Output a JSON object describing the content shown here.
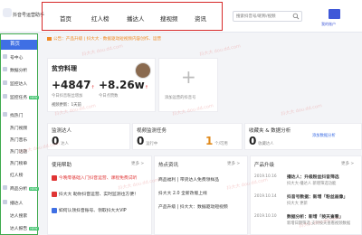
{
  "app": {
    "title": "抖音号运营助手"
  },
  "nav": {
    "items": [
      "首页",
      "红人榜",
      "播达人",
      "搜视频",
      "资讯"
    ]
  },
  "search": {
    "placeholder": "搜索抖音号/昵称/视频"
  },
  "user": {
    "label": "我的账户"
  },
  "sidebar": {
    "home": "首页",
    "items": [
      {
        "label": "号中心",
        "new": false
      },
      {
        "label": "数据分析",
        "new": false
      },
      {
        "label": "监控达人",
        "new": false
      },
      {
        "label": "监控任务",
        "new": true
      },
      {
        "label": "找热门",
        "new": false
      },
      {
        "label": "热门视频",
        "new": false
      },
      {
        "label": "热门音乐",
        "new": false
      },
      {
        "label": "热门话题",
        "new": false
      },
      {
        "label": "热门榜单",
        "new": false
      },
      {
        "label": "红人榜",
        "new": false
      },
      {
        "label": "商品分析",
        "new": true
      },
      {
        "label": "播达人",
        "new": false
      },
      {
        "label": "达人搜索",
        "new": false
      },
      {
        "label": "达人报告",
        "new": true
      }
    ]
  },
  "notice": {
    "text": "公告：产品升级 | 抖大大 · 数据驱动短视频内容创作、运营"
  },
  "account": {
    "name": "贫穷料理",
    "fans_value": "+4847",
    "fans_label": "今日抖音粉丝增加",
    "likes_value": "+8.26w",
    "likes_label": "今日点赞数",
    "video_label": "视频更新：1天前"
  },
  "add_account": {
    "label": "添加运营的抖音号"
  },
  "stats": [
    {
      "title": "监测达人",
      "value": "0",
      "unit": "达人"
    },
    {
      "title": "视频监测任务",
      "value": "0",
      "unit": "运行中",
      "value2": "1",
      "unit2": "个/可用"
    },
    {
      "title": "收藏夹 & 数据分析",
      "value": "0",
      "unit": "收藏达人",
      "link": "添加数据分析"
    }
  ],
  "help": {
    "title": "使用帮助",
    "more": "更多 >",
    "items": [
      {
        "text": "今晚零基础入门抖音运营、课程免费试听"
      },
      {
        "text": "抖大大 助你抖音运营、实时监测也方便！"
      },
      {
        "text": "如何认领抖音账号、领取抖大大VIP"
      }
    ]
  },
  "hot": {
    "title": "热点资讯",
    "more": "更多 >",
    "items": [
      "商品福利 | 带货达人免费领样品",
      "抖大大 2.0 全新改版上线",
      "产品升级 | 抖大大：数据驱动短视频"
    ]
  },
  "updates": {
    "title": "产品升级",
    "more": "更多 >",
    "entries": [
      {
        "date": "2019.10.16",
        "title": "播达人：升级粉丝抖音筛选",
        "desc": "抖大大·播达人 新增筛选功能"
      },
      {
        "date": "2019.10.14",
        "title": "抖音号数据：新增「粉丝画像」",
        "desc": "抖大大 更新"
      },
      {
        "date": "2019.10.10",
        "title": "数据分析：新增「按天查看」",
        "desc": "新增日期筛选 支持按天查看视频数据"
      }
    ]
  },
  "watermark": {
    "text": "抖大大 dou.dd.com"
  }
}
